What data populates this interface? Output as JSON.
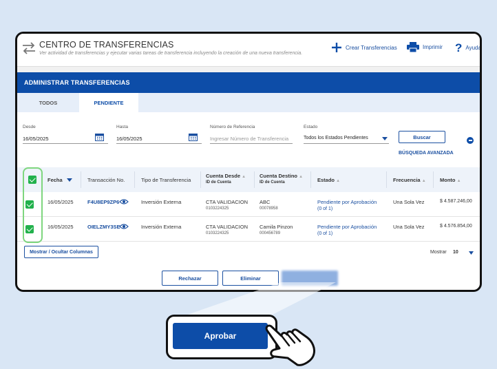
{
  "header": {
    "title": "CENTRO DE TRANSFERENCIAS",
    "subtitle": "Ver actividad de transferencias y ejecutar varias tareas de transferencia incluyendo la creación de una nueva transferencia.",
    "crear_label": "Crear Transferencias",
    "imprimir_label": "Imprimir",
    "ayuda_label": "Ayuda"
  },
  "section_title": "ADMINISTRAR TRANSFERENCIAS",
  "tabs": [
    {
      "label": "TODOS",
      "active": false
    },
    {
      "label": "PENDIENTE",
      "active": true
    }
  ],
  "filters": {
    "desde_label": "Desde",
    "desde_value": "16/05/2025",
    "hasta_label": "Hasta",
    "hasta_value": "16/05/2025",
    "ref_label": "Número de Referencia",
    "ref_placeholder": "Ingresar Número de Transferencia",
    "estado_label": "Estado",
    "estado_value": "Todos los Estados Pendientes",
    "buscar_label": "Buscar",
    "avanzada_label": "BÚSQUEDA AVANZADA"
  },
  "table": {
    "columns": {
      "fecha": "Fecha",
      "transaccion": "Transacción No.",
      "tipo": "Tipo de Transferencia",
      "desde": "Cuenta Desde",
      "desde_sub": "ID de Cuenta",
      "destino": "Cuenta Destino",
      "destino_sub": "ID de Cuenta",
      "estado": "Estado",
      "frecuencia": "Frecuencia",
      "monto": "Monto"
    },
    "rows": [
      {
        "fecha": "16/05/2025",
        "transaccion": "F4U8EP9ZP6",
        "tipo": "Inversión Externa",
        "desde": "CTA VALIDACION",
        "desde_id": "0103224325",
        "destino": "ABC",
        "destino_id": "00078958",
        "estado": "Pendiente por Aprobación",
        "estado2": "(0 of 1)",
        "frecuencia": "Una Sola Vez",
        "monto": "$ 4.587.246,00"
      },
      {
        "fecha": "16/05/2025",
        "transaccion": "OIELZMY3SE",
        "tipo": "Inversión Externa",
        "desde": "CTA VALIDACION",
        "desde_id": "0103224325",
        "destino": "Camila Pinzon",
        "destino_id": "000456789",
        "estado": "Pendiente por Aprobación",
        "estado2": "(0 of 1)",
        "frecuencia": "Una Sola Vez",
        "monto": "$ 4.576.854,00"
      }
    ]
  },
  "columns_button": "Mostrar / Ocultar Columnas",
  "pagination": {
    "label": "Mostrar",
    "value": "10"
  },
  "actions": {
    "rechazar": "Rechazar",
    "eliminar": "Eliminar",
    "aprobar": "Aprobar"
  },
  "colors": {
    "primary": "#0d4da8",
    "check": "#22b14c",
    "highlight": "#7ed67e",
    "background": "#d9e6f5"
  }
}
